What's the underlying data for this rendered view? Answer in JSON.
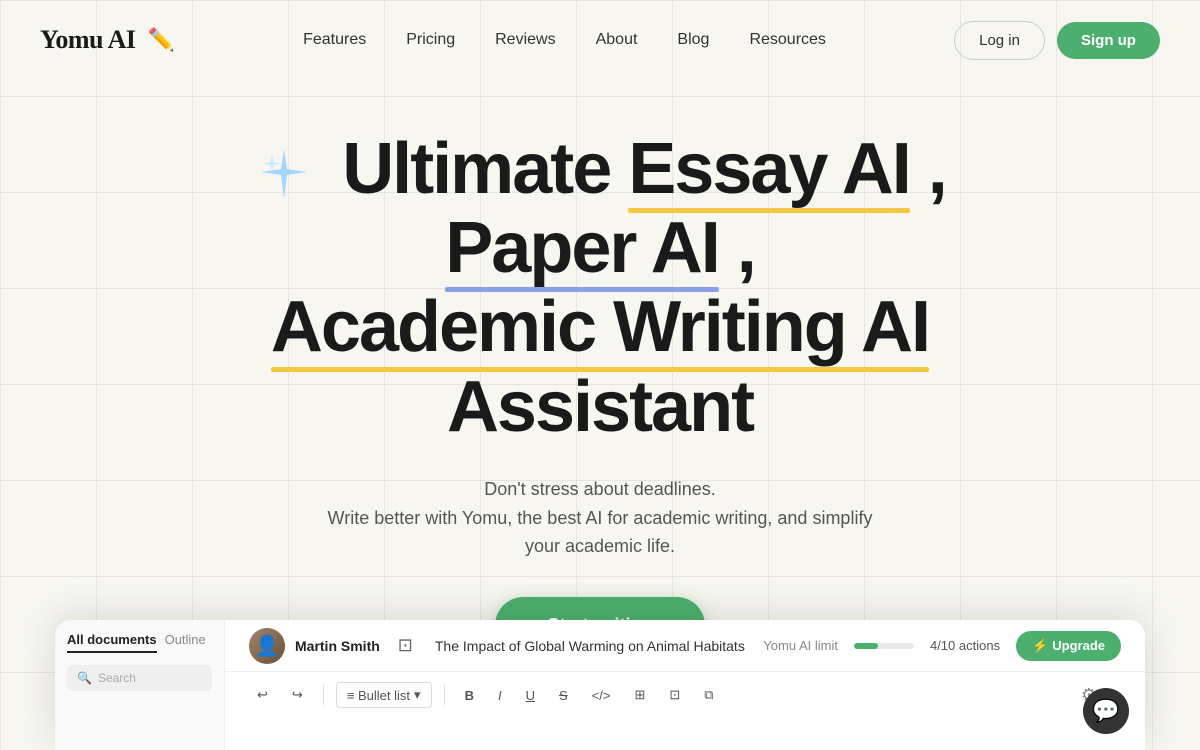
{
  "brand": {
    "name": "Yomu AI",
    "logo_icon": "✏️"
  },
  "nav": {
    "links": [
      {
        "id": "features",
        "label": "Features"
      },
      {
        "id": "pricing",
        "label": "Pricing"
      },
      {
        "id": "reviews",
        "label": "Reviews"
      },
      {
        "id": "about",
        "label": "About"
      },
      {
        "id": "blog",
        "label": "Blog"
      },
      {
        "id": "resources",
        "label": "Resources"
      }
    ],
    "login_label": "Log in",
    "signup_label": "Sign up"
  },
  "hero": {
    "title_part1": "Ultimate ",
    "title_essay": "Essay AI",
    "title_comma": " , ",
    "title_paper": "Paper AI",
    "title_part2": " ,",
    "title_line2_1": "Academic Writing AI",
    "title_line2_2": " Assistant",
    "subtitle_line1": "Don't stress about deadlines.",
    "subtitle_line2": "Write better with Yomu, the best AI for academic writing, and simplify your academic life.",
    "cta_label": "Start writing"
  },
  "app_preview": {
    "user_name": "Martin Smith",
    "doc_title": "The Impact of Global Warming on Animal Habitats",
    "limit_label": "Yomu AI limit",
    "limit_count": "4/10 actions",
    "upgrade_label": "Upgrade",
    "tab_all": "All documents",
    "tab_outline": "Outline",
    "search_placeholder": "Search",
    "toolbar": {
      "bullet_list": "≡ Bullet list",
      "bold": "B",
      "italic": "I",
      "underline": "U",
      "strikethrough": "S",
      "code": "</>",
      "table": "⊞",
      "image": "⊡",
      "link": "⧉"
    }
  },
  "colors": {
    "green": "#4caf6e",
    "yellow_underline": "#f5c842",
    "blue_underline": "#8b9fe8",
    "background": "#f7f6f1"
  }
}
